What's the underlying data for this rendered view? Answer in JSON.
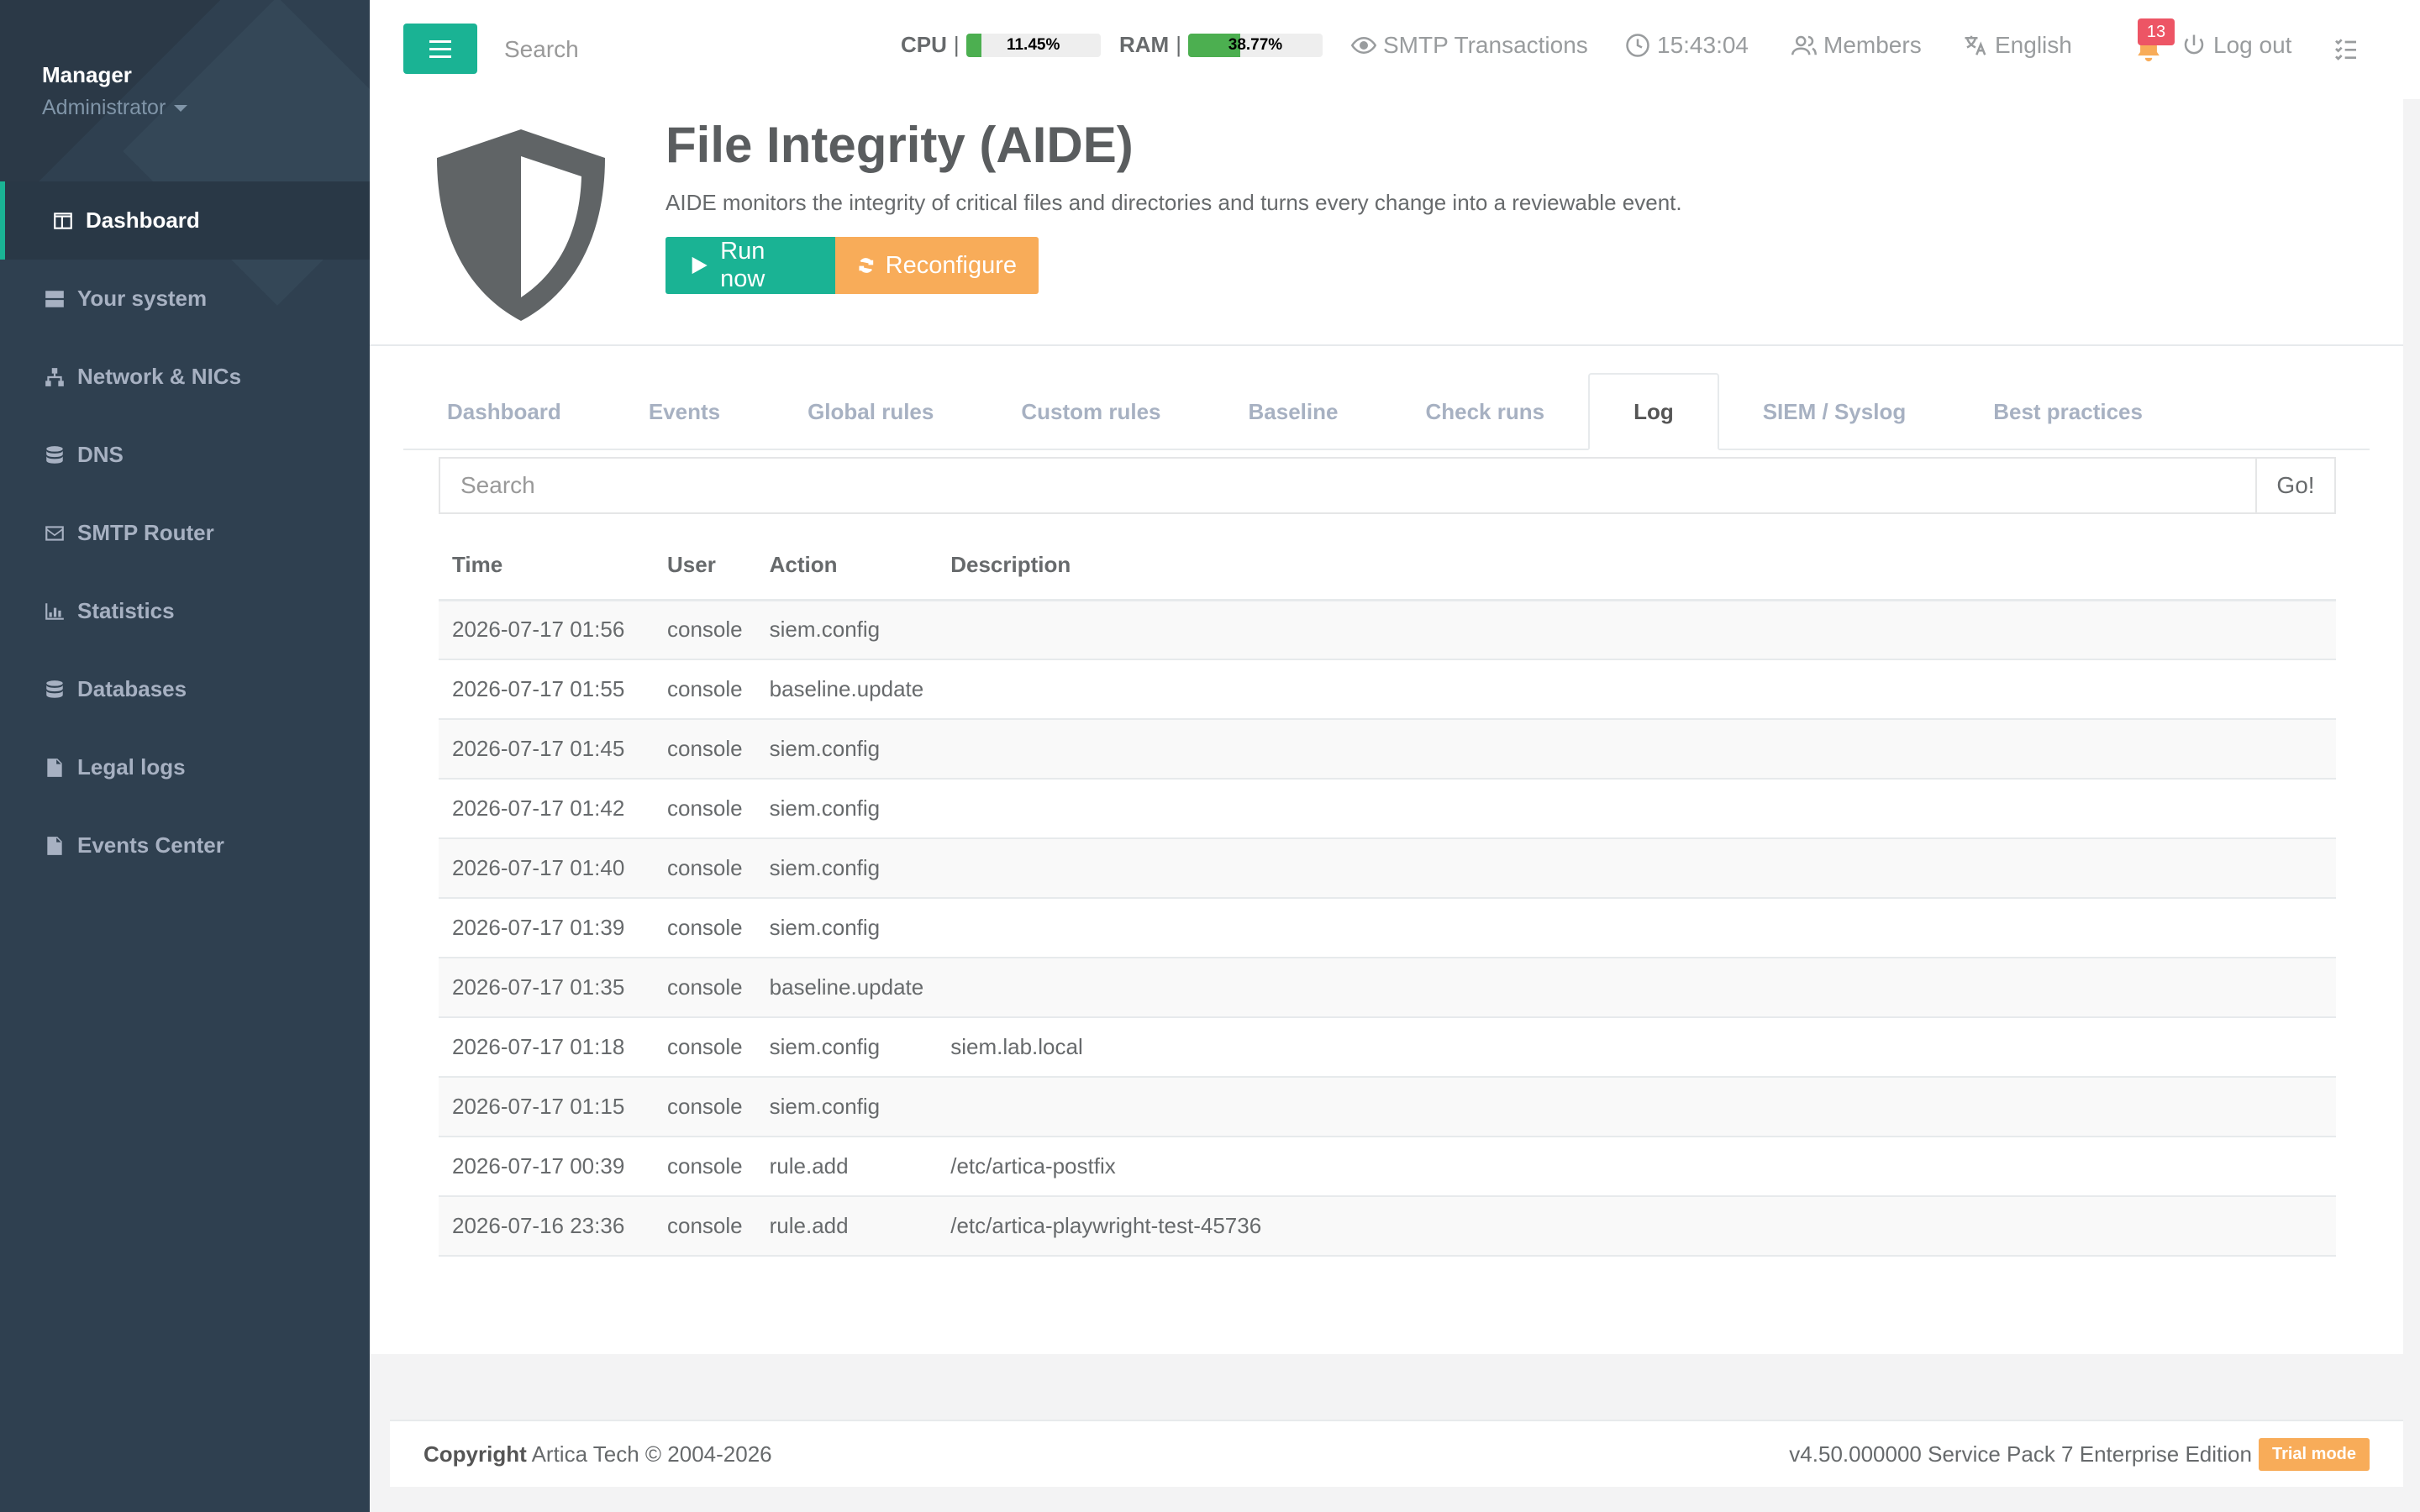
{
  "sidebar": {
    "profile_name": "Manager",
    "profile_role": "Administrator",
    "items": [
      {
        "label": "Dashboard",
        "icon": "table-icon"
      },
      {
        "label": "Your system",
        "icon": "server-icon"
      },
      {
        "label": "Network & NICs",
        "icon": "sitemap-icon"
      },
      {
        "label": "DNS",
        "icon": "database-icon"
      },
      {
        "label": "SMTP Router",
        "icon": "envelope-icon"
      },
      {
        "label": "Statistics",
        "icon": "chart-icon"
      },
      {
        "label": "Databases",
        "icon": "database-icon"
      },
      {
        "label": "Legal logs",
        "icon": "file-icon"
      },
      {
        "label": "Events Center",
        "icon": "file-icon"
      }
    ],
    "active_index": 0
  },
  "topbar": {
    "search_placeholder": "Search",
    "cpu_label": "CPU",
    "cpu_value": "11.45%",
    "cpu_percent": 11.45,
    "ram_label": "RAM",
    "ram_value": "38.77%",
    "ram_percent": 38.77,
    "separator": "|",
    "smtp_transactions": "SMTP Transactions",
    "clock": "15:43:04",
    "members": "Members",
    "language": "English",
    "notifications_count": "13",
    "logout": "Log out"
  },
  "header": {
    "title": "File Integrity (AIDE)",
    "description": "AIDE monitors the integrity of critical files and directories and turns every change into a reviewable event.",
    "run_now": "Run now",
    "reconfigure": "Reconfigure"
  },
  "tabs": [
    {
      "label": "Dashboard",
      "active": false
    },
    {
      "label": "Events",
      "active": false
    },
    {
      "label": "Global rules",
      "active": false
    },
    {
      "label": "Custom rules",
      "active": false
    },
    {
      "label": "Baseline",
      "active": false
    },
    {
      "label": "Check runs",
      "active": false
    },
    {
      "label": "Log",
      "active": true
    },
    {
      "label": "SIEM / Syslog",
      "active": false
    },
    {
      "label": "Best practices",
      "active": false
    }
  ],
  "log": {
    "search_placeholder": "Search",
    "go_label": "Go!",
    "columns": [
      "Time",
      "User",
      "Action",
      "Description"
    ],
    "rows": [
      [
        "2026-07-17 01:56",
        "console",
        "siem.config",
        ""
      ],
      [
        "2026-07-17 01:55",
        "console",
        "baseline.update",
        ""
      ],
      [
        "2026-07-17 01:45",
        "console",
        "siem.config",
        ""
      ],
      [
        "2026-07-17 01:42",
        "console",
        "siem.config",
        ""
      ],
      [
        "2026-07-17 01:40",
        "console",
        "siem.config",
        ""
      ],
      [
        "2026-07-17 01:39",
        "console",
        "siem.config",
        ""
      ],
      [
        "2026-07-17 01:35",
        "console",
        "baseline.update",
        ""
      ],
      [
        "2026-07-17 01:18",
        "console",
        "siem.config",
        "siem.lab.local"
      ],
      [
        "2026-07-17 01:15",
        "console",
        "siem.config",
        ""
      ],
      [
        "2026-07-17 00:39",
        "console",
        "rule.add",
        "/etc/artica-postfix"
      ],
      [
        "2026-07-16 23:36",
        "console",
        "rule.add",
        "/etc/artica-playwright-test-45736"
      ]
    ]
  },
  "footer": {
    "copyright_bold": "Copyright",
    "copyright_text": "Artica Tech © 2004-2026",
    "version": "v4.50.000000 Service Pack 7 Enterprise Edition",
    "trial": "Trial mode"
  },
  "colors": {
    "primary": "#1ab394",
    "warning": "#f8ac59",
    "sidebar": "#2f4050",
    "danger": "#ed5565"
  }
}
